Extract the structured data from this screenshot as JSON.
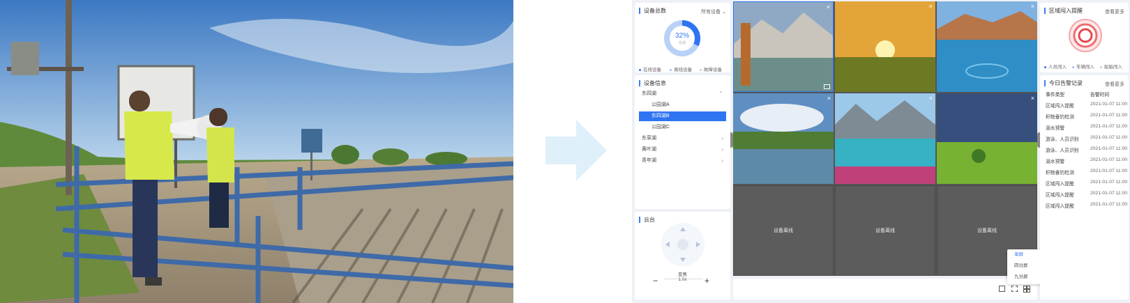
{
  "colors": {
    "accent": "#2f74f1",
    "alert": "#e8454a",
    "arrow": "#dff0fb",
    "offline_bg": "#5c5c5c"
  },
  "devices": {
    "title": "设备总数",
    "filter": "所有设备",
    "percent": "32%",
    "percent_sub": "在线",
    "online_fraction": 0.32,
    "legend": [
      "在线设备",
      "离线设备",
      "故障设备"
    ]
  },
  "info": {
    "title": "设备信息",
    "tree": [
      {
        "label": "东四湖",
        "expanded": true
      },
      {
        "label": "公园湖A"
      },
      {
        "label": "东四湖B",
        "selected": true
      },
      {
        "label": "公园湖C"
      },
      {
        "label": "东草湖"
      },
      {
        "label": "黄叶湖"
      },
      {
        "label": "青年湖"
      }
    ]
  },
  "ptz": {
    "title": "云台",
    "zoom_label": "变焦",
    "zoom_value": "1.0x",
    "minus": "−",
    "plus": "+"
  },
  "videos": {
    "offline_label": "设备离线",
    "tabs_icons": [
      "screenshot-icon",
      "fullscreen-icon",
      "grid-layout-icon"
    ]
  },
  "layout_menu": {
    "items": [
      "单屏",
      "四分屏",
      "九分屏"
    ],
    "active": 0
  },
  "intrusion": {
    "title": "区域闯入提醒",
    "link": "查看更多",
    "legend": [
      "人员闯入",
      "车辆闯入",
      "船舶闯入"
    ]
  },
  "alarms": {
    "title": "今日告警记录",
    "link": "查看更多",
    "headers": [
      "事件类型",
      "告警时间"
    ],
    "rows": [
      [
        "区域闯入提醒",
        "2021-01-07 11:00"
      ],
      [
        "积物垂钓检测",
        "2021-01-07 11:00"
      ],
      [
        "溺水预警",
        "2021-01-07 11:00"
      ],
      [
        "游泳、人员识别",
        "2021-01-07 11:00"
      ],
      [
        "游泳、人员识别",
        "2021-01-07 11:00"
      ],
      [
        "溺水预警",
        "2021-01-07 11:00"
      ],
      [
        "积物垂钓检测",
        "2021-01-07 11:00"
      ],
      [
        "区域闯入提醒",
        "2021-01-07 11:00"
      ],
      [
        "区域闯入提醒",
        "2021-01-07 11:00"
      ],
      [
        "区域闯入提醒",
        "2021-01-07 11:00"
      ]
    ]
  }
}
